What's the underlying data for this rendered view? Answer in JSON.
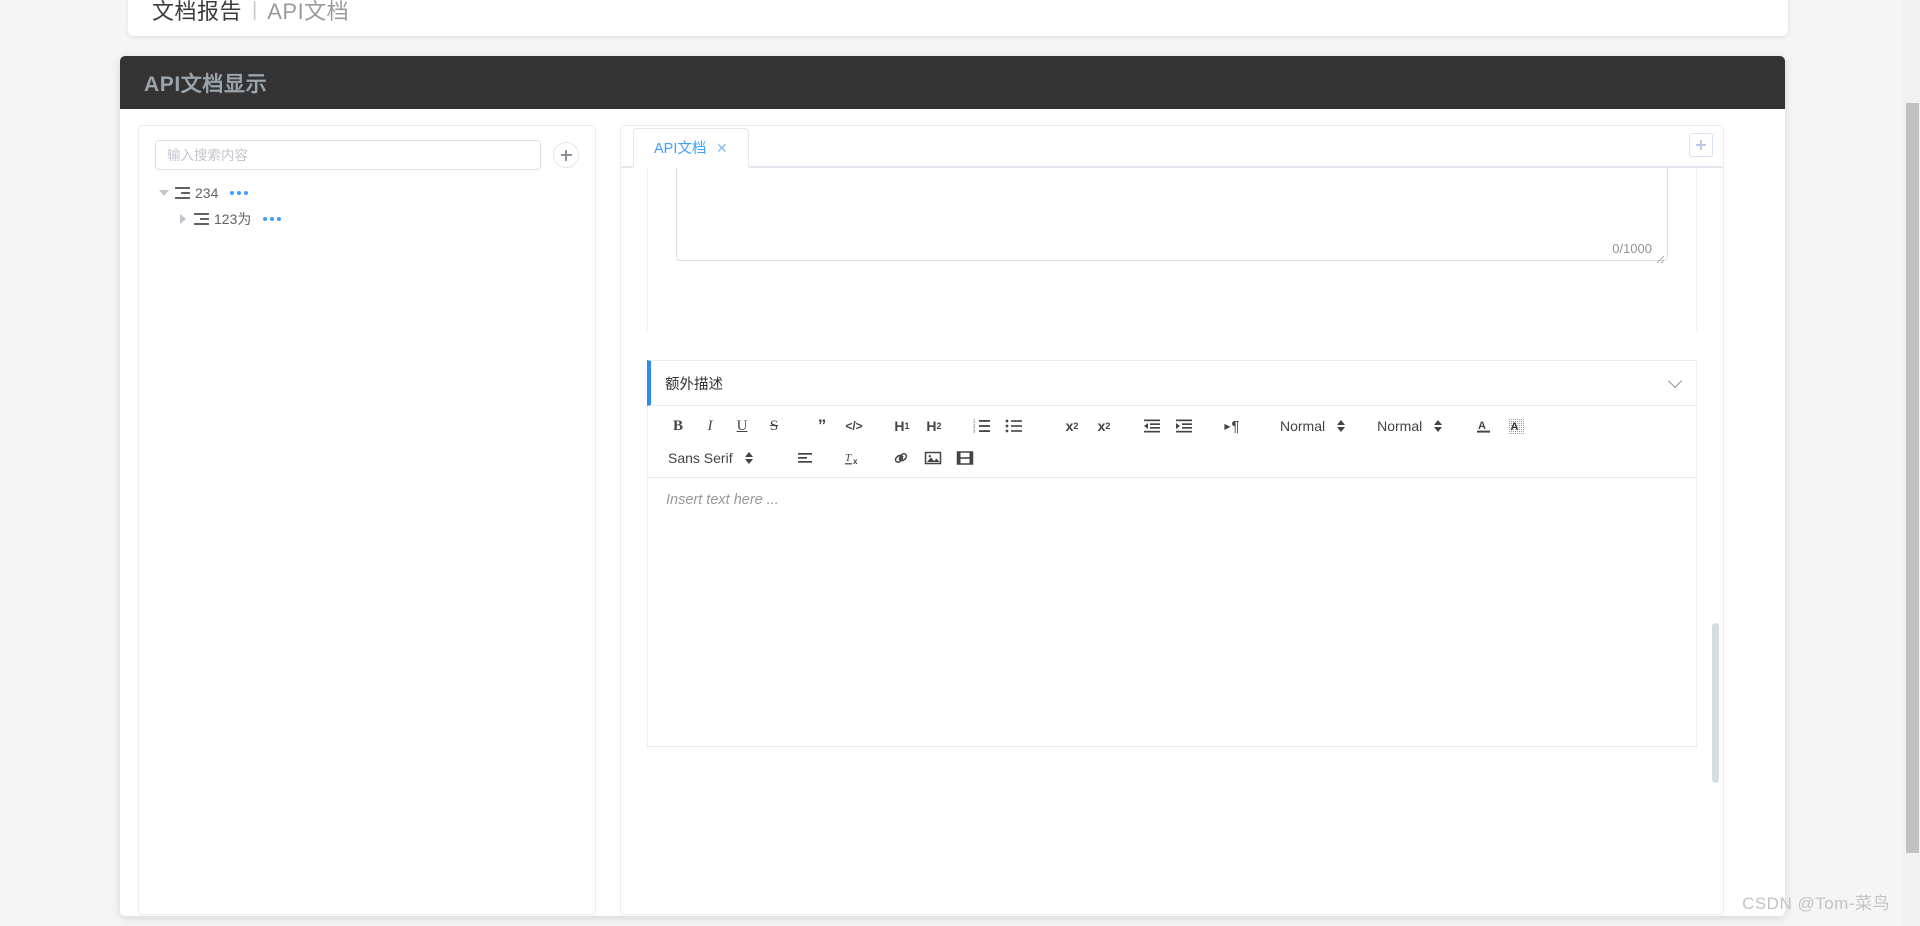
{
  "breadcrumb": {
    "current": "文档报告",
    "separator": "|",
    "sub": "API文档"
  },
  "panel": {
    "title": "API文档显示"
  },
  "tree": {
    "search_placeholder": "输入搜索内容",
    "search_value": "",
    "add_button_icon": "plus-icon",
    "nodes": [
      {
        "label": "234",
        "expanded": true,
        "icon": "document-lines-icon",
        "more_icon": "more-dots-icon",
        "indent": 0
      },
      {
        "label": "123为",
        "expanded": false,
        "icon": "document-lines-icon",
        "more_icon": "more-dots-icon",
        "indent": 1
      }
    ]
  },
  "tabs": {
    "items": [
      {
        "label": "API文档",
        "active": true,
        "close_icon": "close-icon"
      }
    ],
    "add_button_icon": "plus-icon"
  },
  "form": {
    "textarea_value": "",
    "textarea_counter": "0/1000",
    "resize_handle_icon": "resize-handle-icon"
  },
  "collapse": {
    "title": "额外描述",
    "expanded": true,
    "chevron_icon": "chevron-down-icon"
  },
  "editor": {
    "placeholder": "Insert text here ...",
    "toolbar_row1": [
      {
        "name": "bold-button",
        "glyph": "B",
        "style": "bold-g"
      },
      {
        "name": "italic-button",
        "glyph": "I",
        "style": "ital-g"
      },
      {
        "name": "underline-button",
        "glyph": "U",
        "style": "und-g"
      },
      {
        "name": "strikethrough-button",
        "glyph": "S",
        "style": "strk-g"
      }
    ],
    "toolbar_row1b": [
      {
        "name": "blockquote-button",
        "glyph": "”"
      },
      {
        "name": "code-block-button",
        "glyph": "</>"
      }
    ],
    "toolbar_headers": [
      {
        "name": "heading-1-button",
        "glyph": "H",
        "sub": "1"
      },
      {
        "name": "heading-2-button",
        "glyph": "H",
        "sub": "2"
      }
    ],
    "toolbar_lists": [
      {
        "name": "ordered-list-button",
        "icon": "ordered-list-icon"
      },
      {
        "name": "bullet-list-button",
        "icon": "bullet-list-icon"
      }
    ],
    "toolbar_scripts": [
      {
        "name": "subscript-button",
        "glyph": "x",
        "sub": "2"
      },
      {
        "name": "superscript-button",
        "glyph": "x",
        "sup": "2"
      }
    ],
    "toolbar_indent": [
      {
        "name": "outdent-button",
        "icon": "outdent-icon"
      },
      {
        "name": "indent-button",
        "icon": "indent-icon"
      }
    ],
    "toolbar_direction": {
      "name": "text-direction-button",
      "glyph": "¶"
    },
    "size_select": {
      "name": "font-size-select",
      "value": "Normal"
    },
    "header_select": {
      "name": "header-level-select",
      "value": "Normal"
    },
    "color_buttons": [
      {
        "name": "font-color-button",
        "glyph": "A"
      },
      {
        "name": "background-color-button",
        "glyph": "A"
      }
    ],
    "font_select": {
      "name": "font-family-select",
      "value": "Sans Serif"
    },
    "toolbar_row2": [
      {
        "name": "align-button",
        "icon": "align-left-icon"
      },
      {
        "name": "clear-format-button",
        "icon": "clear-format-icon"
      },
      {
        "name": "link-button",
        "icon": "link-icon"
      },
      {
        "name": "image-button",
        "icon": "image-icon"
      },
      {
        "name": "video-button",
        "icon": "video-icon"
      }
    ]
  },
  "watermark": "CSDN @Tom-菜鸟",
  "colors": {
    "accent_blue": "#409eff",
    "collapse_accent": "#2d8cf0",
    "header_dark": "#333333",
    "header_title": "#9aa4ab"
  }
}
